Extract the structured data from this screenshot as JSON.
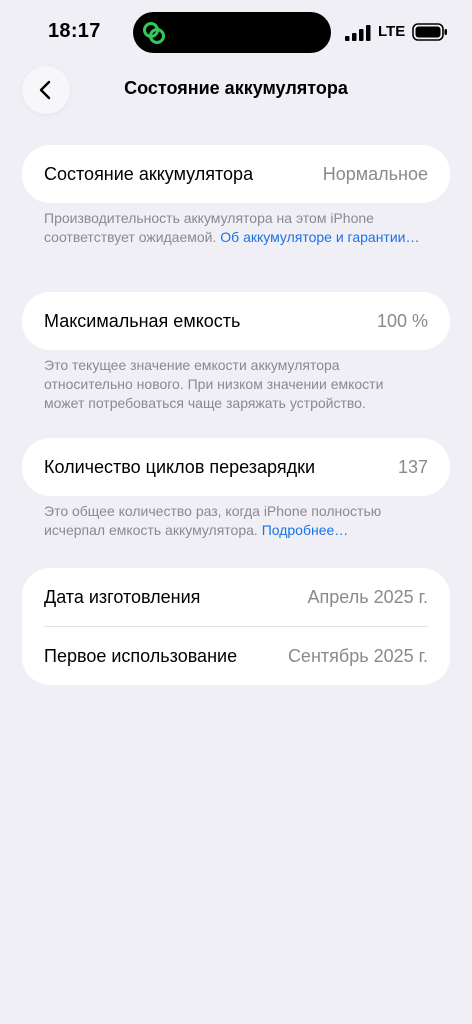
{
  "status_bar": {
    "time": "18:17",
    "network": "LTE"
  },
  "nav": {
    "title": "Состояние аккумулятора"
  },
  "battery_health": {
    "label": "Состояние аккумулятора",
    "value": "Нормальное",
    "footnote": "Производительность аккумулятора на этом iPhone соответствует ожидаемой. ",
    "link": "Об аккумуляторе и гарантии…"
  },
  "max_capacity": {
    "label": "Максимальная емкость",
    "value": "100 %",
    "footnote": "Это текущее значение емкости аккумулятора относительно нового. При низком значении емкости может потребоваться чаще заряжать устройство."
  },
  "cycle_count": {
    "label": "Количество циклов перезарядки",
    "value": "137",
    "footnote": "Это общее количество раз, когда iPhone полностью исчерпал емкость аккумулятора. ",
    "link": "Подробнее…"
  },
  "dates": {
    "manufacture_label": "Дата изготовления",
    "manufacture_value": "Апрель 2025 г.",
    "first_use_label": "Первое использование",
    "first_use_value": "Сентябрь 2025 г."
  },
  "colors": {
    "background": "#f0eff5",
    "card": "#ffffff",
    "secondary_text": "#8a8a8e",
    "link": "#1a73e8",
    "island_icon": "#34c759"
  },
  "icons": {
    "back": "chevron-left-icon",
    "island": "link-rings-icon",
    "signal": "cellular-signal-icon",
    "battery": "battery-icon"
  }
}
